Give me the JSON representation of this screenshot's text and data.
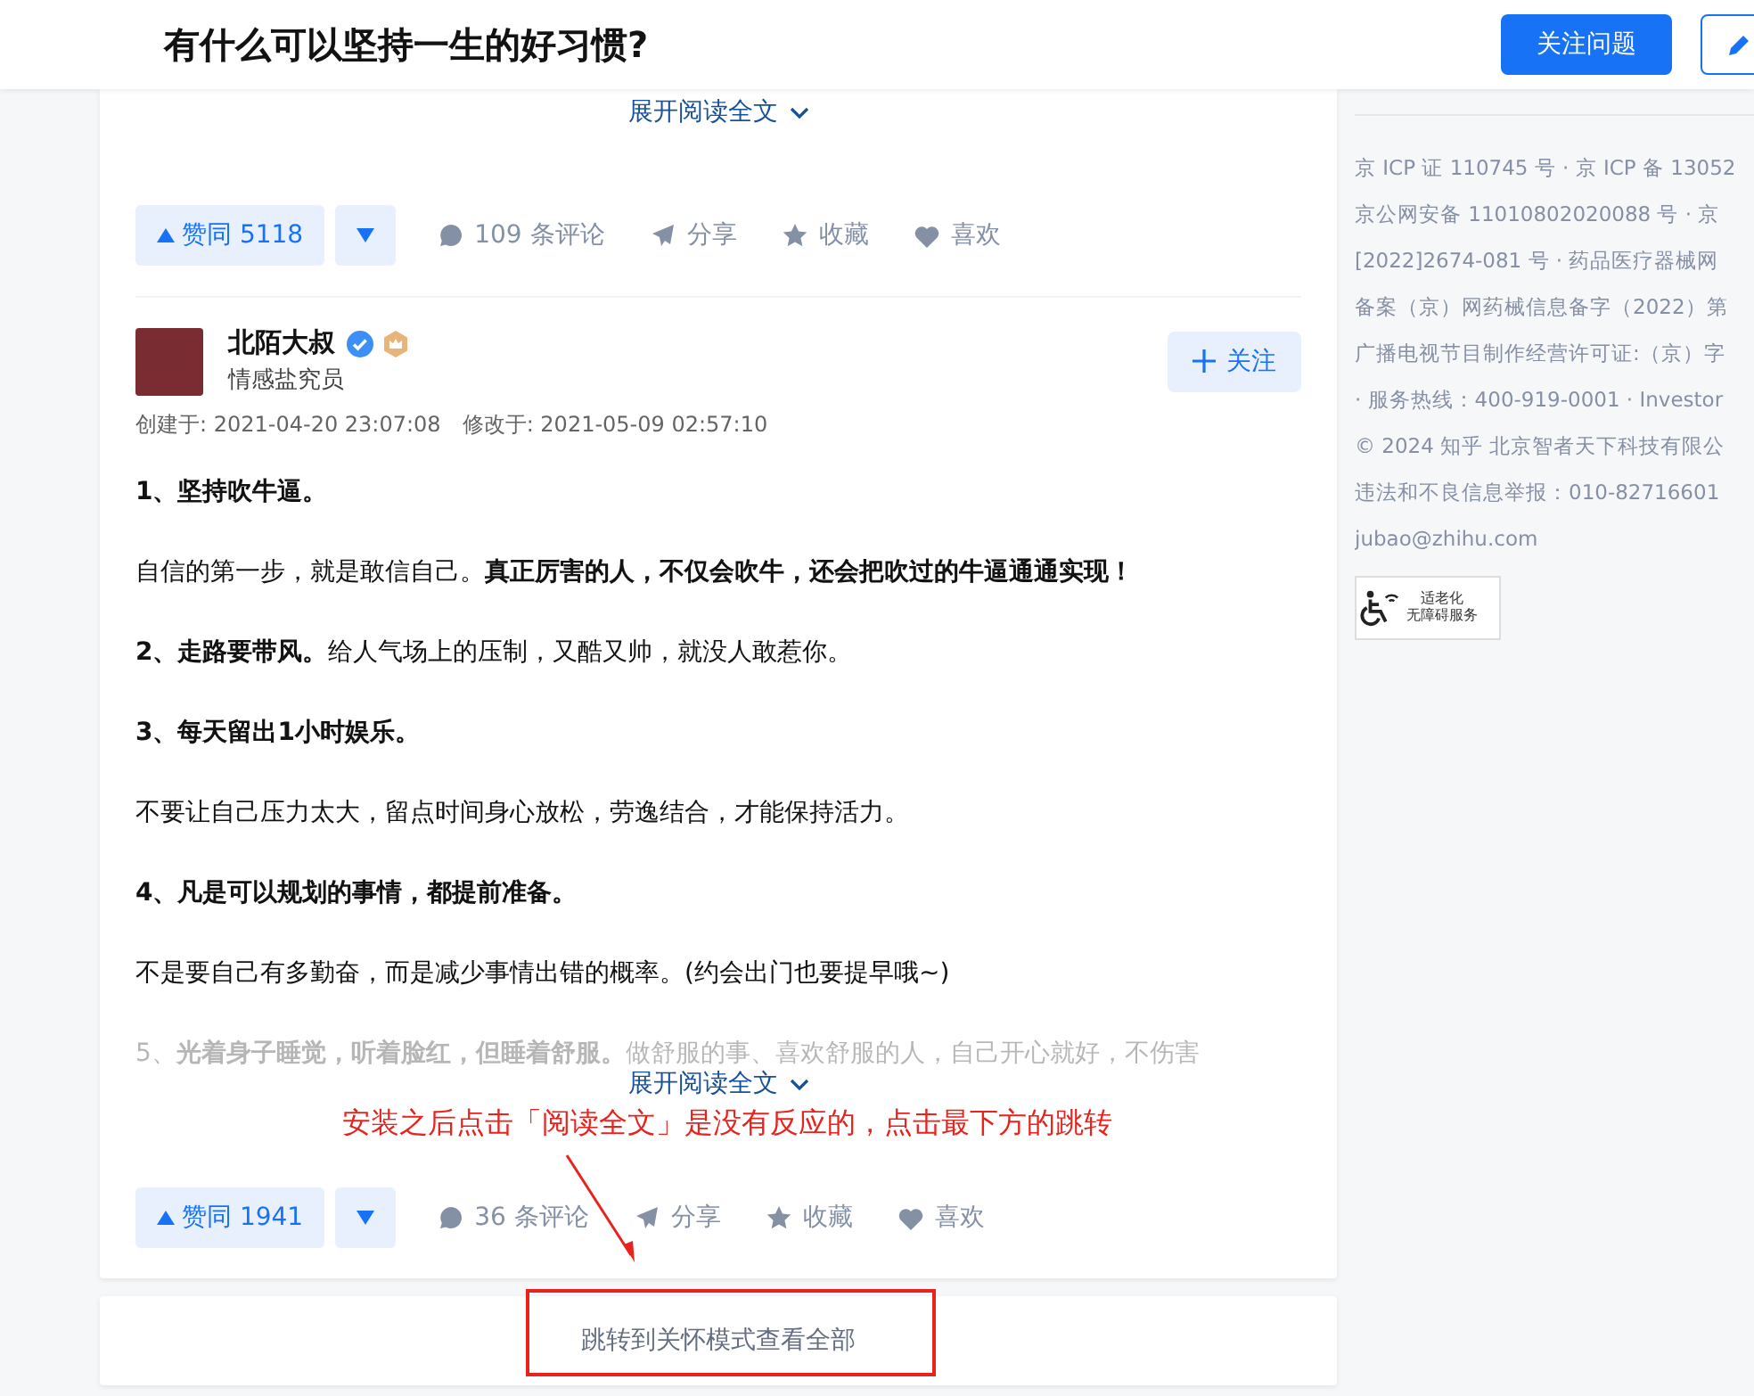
{
  "header": {
    "title": "有什么可以坚持一生的好习惯?",
    "follow_button": "关注问题"
  },
  "answers": [
    {
      "expand_link": "展开阅读全文",
      "actions": {
        "upvote": "赞同 5118",
        "comments": "109 条评论",
        "share": "分享",
        "favorite": "收藏",
        "like": "喜欢"
      }
    },
    {
      "author": {
        "name": "北陌大叔",
        "verified": true,
        "bio": "情感盐究员",
        "follow_button": "关注"
      },
      "created": "创建于: 2021-04-20 23:07:08",
      "modified": "修改于: 2021-05-09 02:57:10",
      "paragraphs": [
        {
          "kind": "heading",
          "text": "1、坚持吹牛逼。",
          "faded": false
        },
        {
          "kind": "body",
          "text": "自信的第一步，就是敢信自己。**真正厉害的人，不仅会吹牛，还会把吹过的牛逼通通实现！**",
          "faded": false
        },
        {
          "kind": "body",
          "text": "**2、走路要带风。**给人气场上的压制，又酷又帅，就没人敢惹你。",
          "faded": false
        },
        {
          "kind": "heading",
          "text": "3、每天留出1小时娱乐。",
          "faded": false
        },
        {
          "kind": "body",
          "text": "不要让自己压力太大，留点时间身心放松，劳逸结合，才能保持活力。",
          "faded": false
        },
        {
          "kind": "heading",
          "text": "4、凡是可以规划的事情，都提前准备。",
          "faded": false
        },
        {
          "kind": "body",
          "text": "不是要自己有多勤奋，而是减少事情出错的概率。(约会出门也要提早哦~)",
          "faded": false
        },
        {
          "kind": "body",
          "text": "5、**光着身子睡觉，听着脸红，但睡着舒服。**做舒服的事、喜欢舒服的人，自己开心就好，不伤害",
          "faded": true
        }
      ],
      "expand_link": "展开阅读全文",
      "actions": {
        "upvote": "赞同 1941",
        "comments": "36 条评论",
        "share": "分享",
        "favorite": "收藏",
        "like": "喜欢"
      }
    }
  ],
  "care_mode_link": "跳转到关怀模式查看全部",
  "sidebar": {
    "footer_lines": [
      "京 ICP 证 110745 号 · 京 ICP 备 13052",
      "京公网安备 11010802020088 号 · 京",
      "[2022]2674-081 号 · 药品医疗器械网",
      "备案（京）网药械信息备字（2022）第",
      "广播电视节目制作经营许可证:（京）字",
      "· 服务热线：400-919-0001 · Investor",
      "© 2024 知乎 北京智者天下科技有限公",
      "违法和不良信息举报：010-82716601",
      "jubao@zhihu.com"
    ],
    "accessibility_badge": [
      "适老化",
      "无障碍服务"
    ]
  },
  "annotation": {
    "text": "安装之后点击「阅读全文」是没有反应的，点击最下方的跳转"
  }
}
